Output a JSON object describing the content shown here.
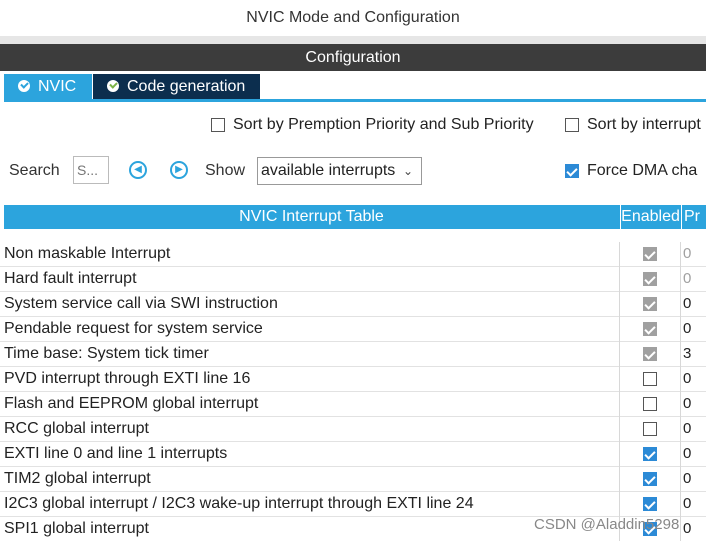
{
  "window": {
    "title": "NVIC Mode and Configuration"
  },
  "config": {
    "header": "Configuration"
  },
  "tabs": [
    {
      "label": "NVIC",
      "active": true
    },
    {
      "label": "Code generation",
      "active": false
    }
  ],
  "options": {
    "sort_priority": {
      "label": "Sort by Premption Priority and Sub Priority",
      "checked": false
    },
    "sort_interrupt": {
      "label": "Sort by interrupt",
      "checked": false
    },
    "force_dma": {
      "label": "Force DMA cha",
      "checked": true
    }
  },
  "search": {
    "label": "Search",
    "placeholder": "S..."
  },
  "show": {
    "label": "Show",
    "selected": "available interrupts"
  },
  "table": {
    "header_name": "NVIC Interrupt Table",
    "header_enabled": "Enabled",
    "header_priority": "Pr",
    "rows": [
      {
        "name": "Non maskable Interrupt",
        "enabled": "locked",
        "priority": "0",
        "priority_dim": true
      },
      {
        "name": "Hard fault interrupt",
        "enabled": "locked",
        "priority": "0",
        "priority_dim": true
      },
      {
        "name": "System service call via SWI instruction",
        "enabled": "locked",
        "priority": "0",
        "priority_dim": false
      },
      {
        "name": "Pendable request for system service",
        "enabled": "locked",
        "priority": "0",
        "priority_dim": false
      },
      {
        "name": "Time base: System tick timer",
        "enabled": "locked",
        "priority": "3",
        "priority_dim": false
      },
      {
        "name": "PVD interrupt through EXTI line 16",
        "enabled": "off",
        "priority": "0",
        "priority_dim": false
      },
      {
        "name": "Flash and EEPROM global interrupt",
        "enabled": "off",
        "priority": "0",
        "priority_dim": false
      },
      {
        "name": "RCC global interrupt",
        "enabled": "off",
        "priority": "0",
        "priority_dim": false
      },
      {
        "name": "EXTI line 0 and line 1 interrupts",
        "enabled": "on",
        "priority": "0",
        "priority_dim": false
      },
      {
        "name": "TIM2 global interrupt",
        "enabled": "on",
        "priority": "0",
        "priority_dim": false
      },
      {
        "name": "I2C3 global interrupt / I2C3 wake-up interrupt through EXTI line 24",
        "enabled": "on",
        "priority": "0",
        "priority_dim": false
      },
      {
        "name": "SPI1 global interrupt",
        "enabled": "on",
        "priority": "0",
        "priority_dim": false
      }
    ]
  },
  "watermark": "CSDN @Aladdin5298",
  "colors": {
    "accent": "#2ca4dd",
    "header_dark": "#3c3c3c",
    "tab_dark": "#0c2e4e"
  }
}
